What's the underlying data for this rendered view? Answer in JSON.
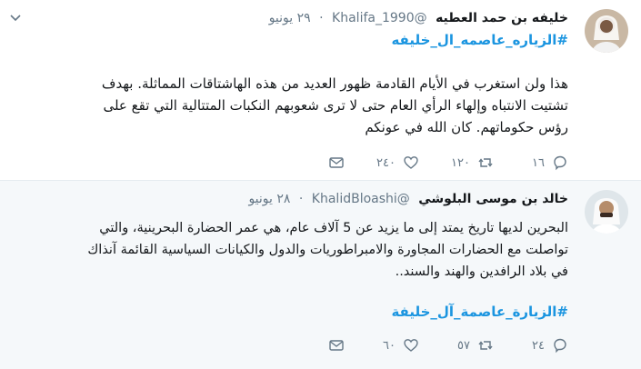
{
  "tweets": [
    {
      "name": "خليفه بن حمد العطيه",
      "handle": "@Khalifa_1990",
      "dot": "·",
      "date": "٢٩ يونيو",
      "hashtag_top": "#الزياره_عاصمه_ال_خليفه",
      "lines": [
        "هذا ولن استغرب في الأيام القادمة ظهور العديد من هذه الهاشتاقات المماثلة. بهدف",
        "تشتيت الانتباه وإلهاء الرأي العام حتى لا ترى شعوبهم النكبات المتتالية التي تقع على",
        "رؤس حكوماتهم. كان الله في عونكم"
      ],
      "replies": "١٦",
      "retweets": "١٢٠",
      "likes": "٢٤٠",
      "colors": {
        "bg": "#ffffff"
      },
      "icons": [
        "chevron-down-icon",
        "reply-icon",
        "retweet-icon",
        "like-icon",
        "message-icon"
      ]
    },
    {
      "name": "خالد بن موسى البلوشي",
      "handle": "@KhalidBloashi",
      "dot": "·",
      "date": "٢٨ يونيو",
      "lines": [
        "البحرين لديها تاريخ يمتد إلى ما يزيد عن 5 آلاف عام، هي عمر الحضارة البحرينية، والتي",
        "تواصلت مع الحضارات المجاورة والامبراطوريات والدول والكيانات السياسية القائمة آنذاك",
        "في بلاد الرافدين والهند والسند.."
      ],
      "hashtag_bottom": "#الزيارة_عاصمة_آل_خليفة",
      "replies": "٢٤",
      "retweets": "٥٧",
      "likes": "٦٠",
      "colors": {
        "bg": "#f5f8fa"
      },
      "icons": [
        "reply-icon",
        "retweet-icon",
        "like-icon",
        "message-icon"
      ]
    }
  ],
  "colors": {
    "link": "#1b95e0",
    "muted": "#657786",
    "text": "#14171a",
    "divider": "#e6ecf0"
  }
}
